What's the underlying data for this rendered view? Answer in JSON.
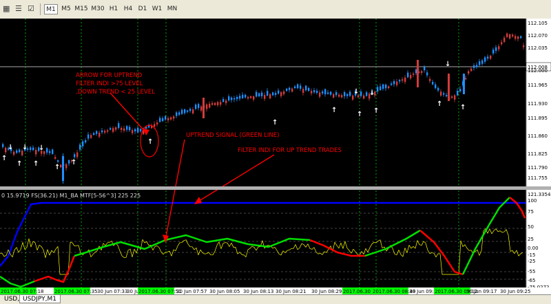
{
  "toolbar": {
    "icons": [
      "chart-properties-icon",
      "terminal-icon",
      "checkbox-icon"
    ],
    "timeframes": [
      "M1",
      "M5",
      "M15",
      "M30",
      "H1",
      "H4",
      "D1",
      "W1",
      "MN"
    ],
    "active_timeframe": "M1"
  },
  "price_axis": {
    "labels": [
      "112.105",
      "112.070",
      "112.035",
      "112.008",
      "112.000",
      "111.965",
      "111.930",
      "111.895",
      "111.860",
      "111.825",
      "111.790",
      "111.755"
    ],
    "current_price": "112.008"
  },
  "indicator": {
    "info_text": "0 15.9719  FS(36.21)  M1_BA MTF[5-56^3] 225 225",
    "axis_labels": [
      "121.3354",
      "100",
      "75",
      "50",
      "25",
      "0.00",
      "-15",
      "-25",
      "-55",
      "-65",
      "-75.0272"
    ]
  },
  "time_axis": {
    "labels": [
      {
        "text": "2017.06.30 07:18",
        "highlighted": true
      },
      {
        "text": "2017.06.30 07:35",
        "highlighted": true
      },
      {
        "text": "30 Jun 07:33",
        "highlighted": false
      },
      {
        "text": "30 Jun 07:41",
        "highlighted": false
      },
      {
        "text": "2017.06.30 07:51",
        "highlighted": true
      },
      {
        "text": "30 Jun 07:57",
        "highlighted": false
      },
      {
        "text": "30 Jun 08:05",
        "highlighted": false
      },
      {
        "text": "30 Jun 08:13",
        "highlighted": false
      },
      {
        "text": "30 Jun 08:21",
        "highlighted": false
      },
      {
        "text": "30 Jun 08:29",
        "highlighted": false
      },
      {
        "text": "2017.06.30 08:45",
        "highlighted": true
      },
      {
        "text": "2017.06.30 08:49",
        "highlighted": true
      },
      {
        "text": "30 Jun 09:0",
        "highlighted": false
      },
      {
        "text": "2017.06.30 09:12",
        "highlighted": true
      },
      {
        "text": "30 Jun 09:17",
        "highlighted": false
      },
      {
        "text": "30 Jun 09:25",
        "highlighted": false
      }
    ]
  },
  "annotations": {
    "arrow_note": [
      "ARROW  FOR UPTREND",
      "FILTER INDI  >75 LEVEL",
      ",DOWN TREND < 25 LEVEL"
    ],
    "uptrend_signal": "UPTREND SIGNAL (GREEN LINE)",
    "filter_note": "FILTER INDI FOR UP TREND TRADES"
  },
  "tabs": [
    "USD,M1",
    "USDJPY,M1"
  ],
  "colors": {
    "background": "#000000",
    "bull_candle": "#1e90ff",
    "bear_candle": "#d23c3c",
    "annotation": "#ff0000",
    "signal_line_up": "#00e000",
    "signal_line_down": "#ff0000",
    "filter_line": "#0000ff",
    "yellow_line": "#ffff00",
    "grid": "#00aa00",
    "highlight": "#00ff00"
  }
}
